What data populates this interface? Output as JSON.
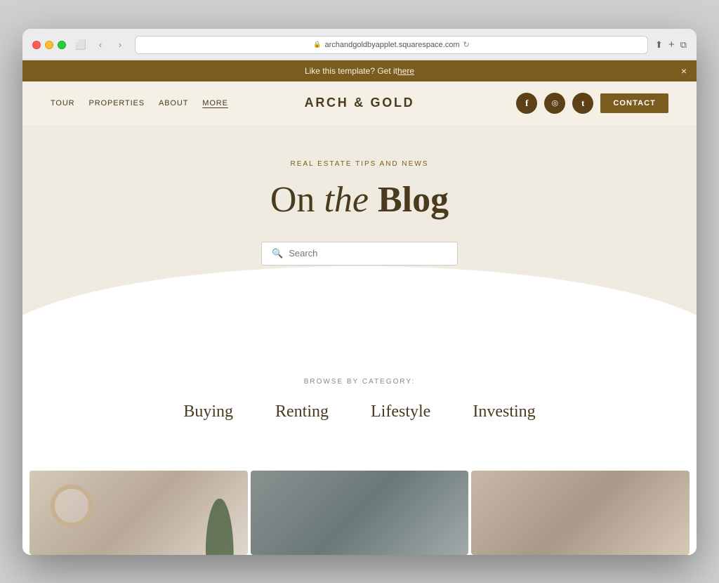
{
  "browser": {
    "url": "archandgoldbyapplet.squarespace.com",
    "back_btn": "‹",
    "forward_btn": "›"
  },
  "announcement": {
    "text": "Like this template? Get it ",
    "link_text": "here",
    "close": "×"
  },
  "nav": {
    "items": [
      {
        "label": "TOUR",
        "active": false
      },
      {
        "label": "PROPERTIES",
        "active": false
      },
      {
        "label": "ABOUT",
        "active": false
      },
      {
        "label": "MORE",
        "active": true
      }
    ],
    "logo": "ARCH & GOLD",
    "contact_label": "CONTACT",
    "social": [
      {
        "icon": "f",
        "name": "facebook"
      },
      {
        "icon": "📷",
        "name": "instagram"
      },
      {
        "icon": "t",
        "name": "twitter"
      }
    ]
  },
  "hero": {
    "subtitle": "REAL ESTATE TIPS AND NEWS",
    "title_prefix": "On ",
    "title_italic": "the",
    "title_suffix": " Blog",
    "search_placeholder": "Search"
  },
  "categories": {
    "browse_label": "BROWSE BY CATEGORY:",
    "items": [
      {
        "label": "Buying"
      },
      {
        "label": "Renting"
      },
      {
        "label": "Lifestyle"
      },
      {
        "label": "Investing"
      }
    ]
  }
}
